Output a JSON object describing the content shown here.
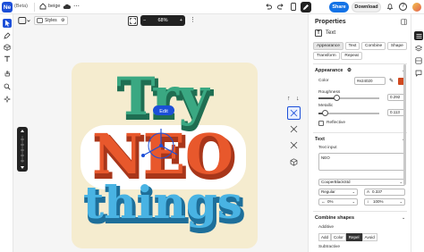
{
  "app": {
    "logo_text": "Ne",
    "beta_label": "(Beta)",
    "doc_title": "beige"
  },
  "header": {
    "share_label": "Share",
    "download_label": "Download",
    "help_glyph": "?"
  },
  "canvas_toolbar": {
    "styles_label": "Styles",
    "zoom_minus": "−",
    "zoom_value": "68%",
    "zoom_plus": "+"
  },
  "artwork": {
    "line1": "Try",
    "line2": "NEO",
    "line3": "things",
    "edit_label": "Edit",
    "colors": {
      "background": "#f5eccf",
      "green": "#2f9a72",
      "orange": "#e2532a",
      "blue": "#3aa7d9",
      "selection": "#1c4fd8"
    }
  },
  "panel": {
    "title": "Properties",
    "object_type": "Text",
    "tabs": [
      "Appearance",
      "Text",
      "Combine",
      "Shape",
      "Transform",
      "Repeat"
    ],
    "appearance": {
      "heading": "Appearance",
      "color_label": "Color",
      "color_value": "#e24020",
      "roughness_label": "Roughness",
      "roughness_value": "0.292",
      "roughness_level": 0.29,
      "metallic_label": "Metallic",
      "metallic_value": "0.113",
      "metallic_level": 0.11,
      "reflective_label": "Reflective"
    },
    "text": {
      "heading": "Text",
      "input_label": "Text input",
      "input_value": "NEO",
      "font": "CooperBlackStd",
      "weight": "Regular",
      "size": "0.337",
      "tracking": "0%",
      "leading": "100%"
    },
    "combine": {
      "heading": "Combine shapes",
      "additive_label": "Additive",
      "options": [
        "Add",
        "Color",
        "Repel",
        "Avoid"
      ],
      "active_option": "Repel",
      "subtractive_label": "Subtractive"
    }
  }
}
